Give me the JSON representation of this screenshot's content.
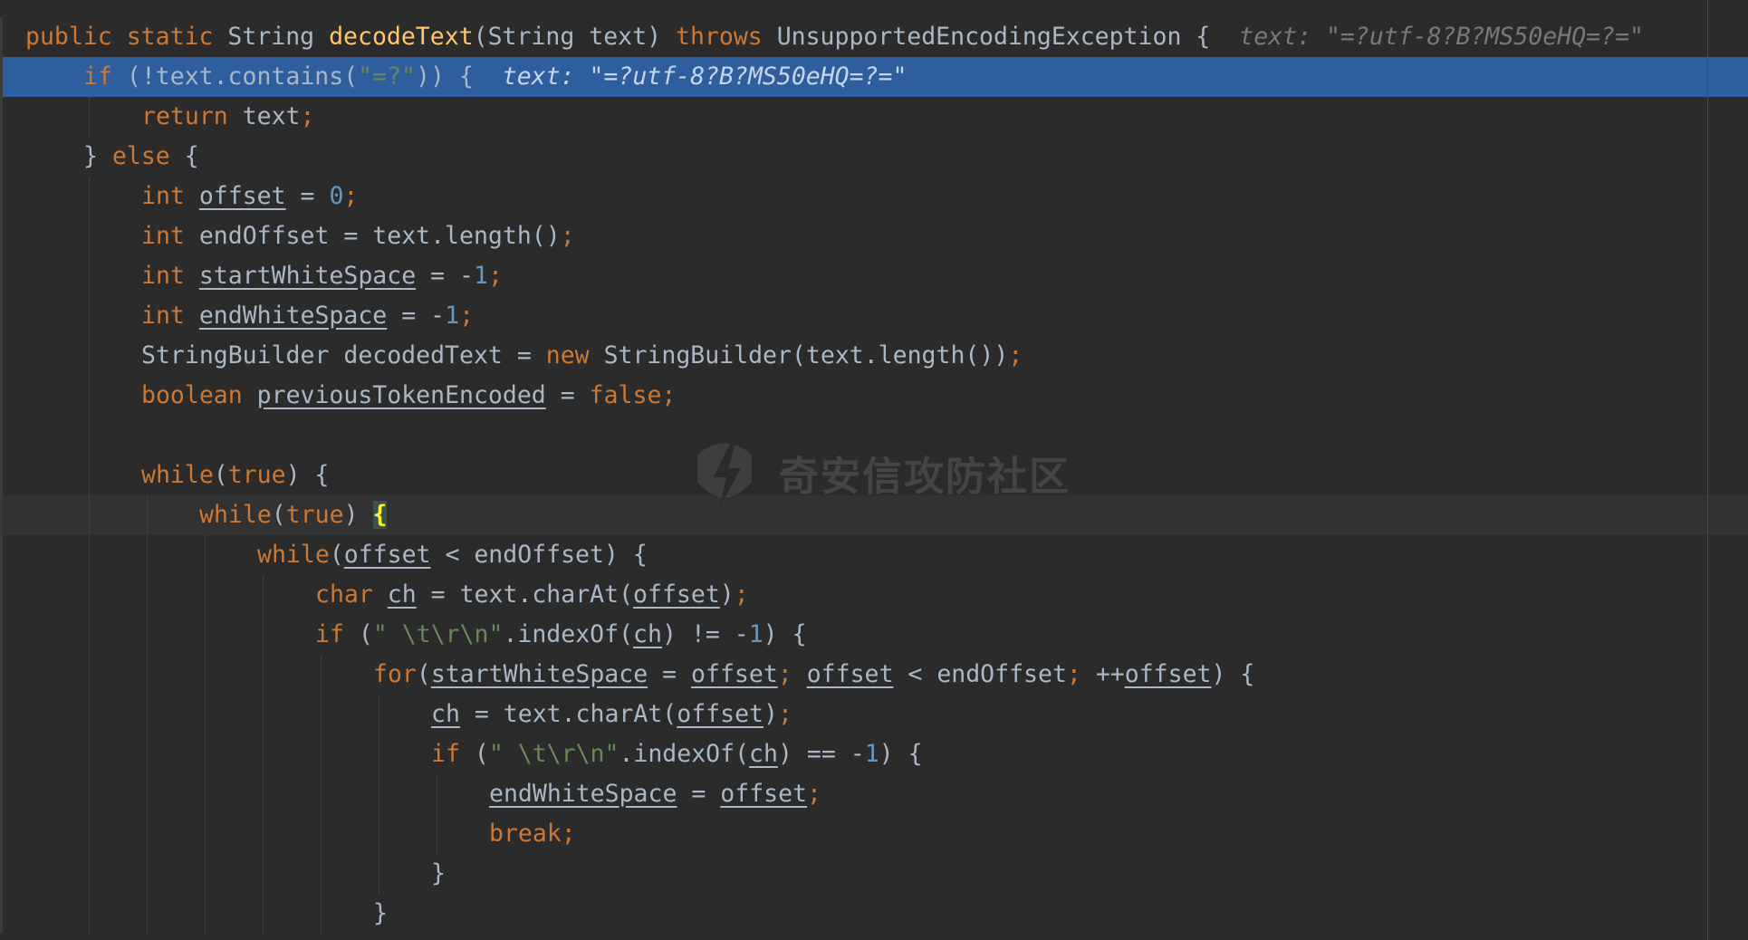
{
  "editor": {
    "lines": [
      {
        "indent": 0,
        "selected": false,
        "tokens": [
          {
            "t": "public",
            "c": "kw"
          },
          {
            "t": " "
          },
          {
            "t": "static",
            "c": "kw"
          },
          {
            "t": " String "
          },
          {
            "t": "decodeText",
            "c": "fn"
          },
          {
            "t": "(String text) "
          },
          {
            "t": "throws",
            "c": "kw"
          },
          {
            "t": " UnsupportedEncodingException {"
          }
        ],
        "hint": "text: \"=?utf-8?B?MS50eHQ=?=\""
      },
      {
        "indent": 1,
        "selected": true,
        "tokens": [
          {
            "t": "if",
            "c": "kw"
          },
          {
            "t": " (!text.contains("
          },
          {
            "t": "\"=?\"",
            "c": "str"
          },
          {
            "t": ")) {"
          }
        ],
        "hint": "text: \"=?utf-8?B?MS50eHQ=?=\""
      },
      {
        "indent": 2,
        "tokens": [
          {
            "t": "return",
            "c": "kw"
          },
          {
            "t": " text"
          },
          {
            "t": ";",
            "c": "kw"
          }
        ]
      },
      {
        "indent": 1,
        "tokens": [
          {
            "t": "} "
          },
          {
            "t": "else",
            "c": "kw"
          },
          {
            "t": " {"
          }
        ]
      },
      {
        "indent": 2,
        "tokens": [
          {
            "t": "int",
            "c": "kw"
          },
          {
            "t": " "
          },
          {
            "t": "offset",
            "c": "var"
          },
          {
            "t": " = "
          },
          {
            "t": "0",
            "c": "num"
          },
          {
            "t": ";",
            "c": "kw"
          }
        ]
      },
      {
        "indent": 2,
        "tokens": [
          {
            "t": "int",
            "c": "kw"
          },
          {
            "t": " endOffset = text.length()"
          },
          {
            "t": ";",
            "c": "kw"
          }
        ]
      },
      {
        "indent": 2,
        "tokens": [
          {
            "t": "int",
            "c": "kw"
          },
          {
            "t": " "
          },
          {
            "t": "startWhiteSpace",
            "c": "var"
          },
          {
            "t": " = -"
          },
          {
            "t": "1",
            "c": "num"
          },
          {
            "t": ";",
            "c": "kw"
          }
        ]
      },
      {
        "indent": 2,
        "tokens": [
          {
            "t": "int",
            "c": "kw"
          },
          {
            "t": " "
          },
          {
            "t": "endWhiteSpace",
            "c": "var"
          },
          {
            "t": " = -"
          },
          {
            "t": "1",
            "c": "num"
          },
          {
            "t": ";",
            "c": "kw"
          }
        ]
      },
      {
        "indent": 2,
        "tokens": [
          {
            "t": "StringBuilder decodedText = "
          },
          {
            "t": "new",
            "c": "kw"
          },
          {
            "t": " StringBuilder(text.length())"
          },
          {
            "t": ";",
            "c": "kw"
          }
        ]
      },
      {
        "indent": 2,
        "tokens": [
          {
            "t": "boolean",
            "c": "kw"
          },
          {
            "t": " "
          },
          {
            "t": "previousTokenEncoded",
            "c": "var"
          },
          {
            "t": " = "
          },
          {
            "t": "false",
            "c": "kw"
          },
          {
            "t": ";",
            "c": "kw"
          }
        ]
      },
      {
        "indent": 2,
        "tokens": []
      },
      {
        "indent": 2,
        "tokens": [
          {
            "t": "while",
            "c": "kw"
          },
          {
            "t": "("
          },
          {
            "t": "true",
            "c": "kw"
          },
          {
            "t": ") {"
          }
        ]
      },
      {
        "indent": 3,
        "current": true,
        "tokens": [
          {
            "t": "while",
            "c": "kw"
          },
          {
            "t": "("
          },
          {
            "t": "true",
            "c": "kw"
          },
          {
            "t": ") "
          },
          {
            "t": "{",
            "c": "brace-hl"
          }
        ]
      },
      {
        "indent": 4,
        "tokens": [
          {
            "t": "while",
            "c": "kw"
          },
          {
            "t": "("
          },
          {
            "t": "offset",
            "c": "var"
          },
          {
            "t": " < endOffset) {"
          }
        ]
      },
      {
        "indent": 5,
        "tokens": [
          {
            "t": "char",
            "c": "kw"
          },
          {
            "t": " "
          },
          {
            "t": "ch",
            "c": "var"
          },
          {
            "t": " = text.charAt("
          },
          {
            "t": "offset",
            "c": "var"
          },
          {
            "t": ")"
          },
          {
            "t": ";",
            "c": "kw"
          }
        ]
      },
      {
        "indent": 5,
        "tokens": [
          {
            "t": "if",
            "c": "kw"
          },
          {
            "t": " ("
          },
          {
            "t": "\" \\t\\r\\n\"",
            "c": "str"
          },
          {
            "t": ".indexOf("
          },
          {
            "t": "ch",
            "c": "var"
          },
          {
            "t": ") != -"
          },
          {
            "t": "1",
            "c": "num"
          },
          {
            "t": ") {"
          }
        ]
      },
      {
        "indent": 6,
        "tokens": [
          {
            "t": "for",
            "c": "kw"
          },
          {
            "t": "("
          },
          {
            "t": "startWhiteSpace",
            "c": "var"
          },
          {
            "t": " = "
          },
          {
            "t": "offset",
            "c": "var"
          },
          {
            "t": ";",
            "c": "kw"
          },
          {
            "t": " "
          },
          {
            "t": "offset",
            "c": "var"
          },
          {
            "t": " < endOffset"
          },
          {
            "t": ";",
            "c": "kw"
          },
          {
            "t": " ++"
          },
          {
            "t": "offset",
            "c": "var"
          },
          {
            "t": ") {"
          }
        ]
      },
      {
        "indent": 7,
        "tokens": [
          {
            "t": "ch",
            "c": "var"
          },
          {
            "t": " = text.charAt("
          },
          {
            "t": "offset",
            "c": "var"
          },
          {
            "t": ")"
          },
          {
            "t": ";",
            "c": "kw"
          }
        ]
      },
      {
        "indent": 7,
        "tokens": [
          {
            "t": "if",
            "c": "kw"
          },
          {
            "t": " ("
          },
          {
            "t": "\" \\t\\r\\n\"",
            "c": "str"
          },
          {
            "t": ".indexOf("
          },
          {
            "t": "ch",
            "c": "var"
          },
          {
            "t": ") == -"
          },
          {
            "t": "1",
            "c": "num"
          },
          {
            "t": ") {"
          }
        ]
      },
      {
        "indent": 8,
        "tokens": [
          {
            "t": "endWhiteSpace",
            "c": "var"
          },
          {
            "t": " = "
          },
          {
            "t": "offset",
            "c": "var"
          },
          {
            "t": ";",
            "c": "kw"
          }
        ]
      },
      {
        "indent": 8,
        "tokens": [
          {
            "t": "break",
            "c": "kw"
          },
          {
            "t": ";",
            "c": "kw"
          }
        ]
      },
      {
        "indent": 7,
        "tokens": [
          {
            "t": "}"
          }
        ]
      },
      {
        "indent": 6,
        "tokens": [
          {
            "t": "}"
          }
        ]
      }
    ]
  },
  "watermark": {
    "text": "奇安信攻防社区",
    "icon": "lightning-shield-icon"
  },
  "colors": {
    "background": "#2b2b2b",
    "keyword": "#cc7832",
    "function": "#ffc66d",
    "number": "#6897bb",
    "string": "#6a8759",
    "selection": "#2f5e9e",
    "text": "#a9b7c6"
  }
}
